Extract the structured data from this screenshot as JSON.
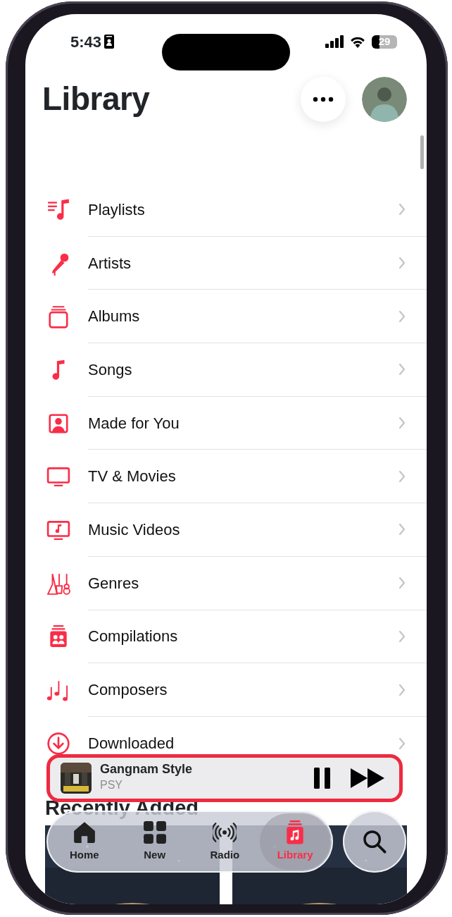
{
  "status_bar": {
    "time": "5:43",
    "battery": "29"
  },
  "header": {
    "title": "Library"
  },
  "library_items": [
    {
      "label": "Playlists",
      "kind": "playlists"
    },
    {
      "label": "Artists",
      "kind": "artists"
    },
    {
      "label": "Albums",
      "kind": "albums"
    },
    {
      "label": "Songs",
      "kind": "songs"
    },
    {
      "label": "Made for You",
      "kind": "made"
    },
    {
      "label": "TV & Movies",
      "kind": "tv"
    },
    {
      "label": "Music Videos",
      "kind": "videos"
    },
    {
      "label": "Genres",
      "kind": "genres"
    },
    {
      "label": "Compilations",
      "kind": "compilations"
    },
    {
      "label": "Composers",
      "kind": "composers"
    },
    {
      "label": "Downloaded",
      "kind": "downloaded"
    }
  ],
  "section": {
    "title": "Recently Added"
  },
  "now_playing": {
    "title": "Gangnam Style",
    "artist": "PSY",
    "playing": true,
    "highlighted": true
  },
  "tab_bar": {
    "tabs": [
      {
        "label": "Home",
        "kind": "home",
        "selected": false
      },
      {
        "label": "New",
        "kind": "new",
        "selected": false
      },
      {
        "label": "Radio",
        "kind": "radio",
        "selected": false
      },
      {
        "label": "Library",
        "kind": "library",
        "selected": true
      }
    ]
  }
}
